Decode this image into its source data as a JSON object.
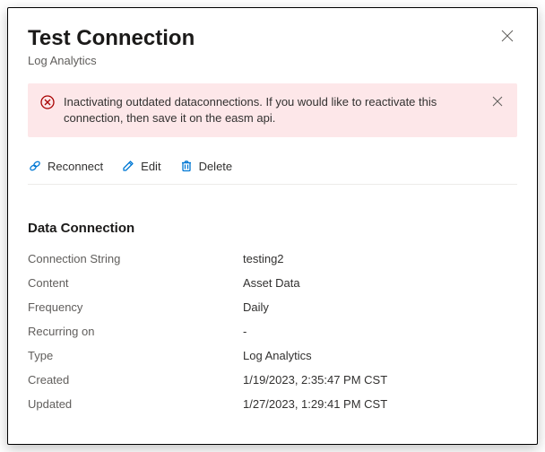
{
  "header": {
    "title": "Test Connection",
    "subtitle": "Log Analytics"
  },
  "alert": {
    "message": "Inactivating outdated dataconnections. If you would like to reactivate this connection, then save it on the easm api."
  },
  "toolbar": {
    "reconnect_label": "Reconnect",
    "edit_label": "Edit",
    "delete_label": "Delete"
  },
  "section": {
    "title": "Data Connection"
  },
  "fields": {
    "connection_string": {
      "label": "Connection String",
      "value": "testing2"
    },
    "content": {
      "label": "Content",
      "value": "Asset Data"
    },
    "frequency": {
      "label": "Frequency",
      "value": "Daily"
    },
    "recurring_on": {
      "label": "Recurring on",
      "value": "-"
    },
    "type": {
      "label": "Type",
      "value": "Log Analytics"
    },
    "created": {
      "label": "Created",
      "value": "1/19/2023, 2:35:47 PM CST"
    },
    "updated": {
      "label": "Updated",
      "value": "1/27/2023, 1:29:41 PM CST"
    }
  }
}
